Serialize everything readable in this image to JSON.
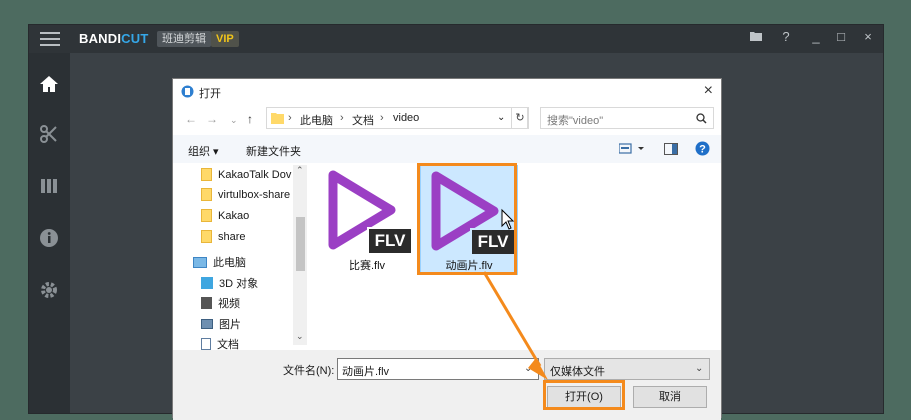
{
  "app": {
    "brand_main": "BANDI",
    "brand_accent": "CUT",
    "brand_sub": "班迪剪辑",
    "vip": "VIP",
    "accent_color": "#35a7e8",
    "vip_color": "#f0c419"
  },
  "window_controls": [
    "folder-icon",
    "?",
    "_",
    "□",
    "×"
  ],
  "sidebar": {
    "items": [
      {
        "name": "home-icon"
      },
      {
        "name": "cut-icon"
      },
      {
        "name": "join-icon"
      },
      {
        "name": "info-icon"
      },
      {
        "name": "settings-icon"
      }
    ]
  },
  "dialog": {
    "title": "打开",
    "breadcrumb": [
      "此电脑",
      "文档",
      "video"
    ],
    "search_placeholder": "搜索\"video\"",
    "toolbar": {
      "organize": "组织 ▾",
      "new_folder": "新建文件夹"
    },
    "tree": [
      {
        "label": "KakaoTalk Dov",
        "icon": "folder"
      },
      {
        "label": "virtulbox-share",
        "icon": "folder"
      },
      {
        "label": "Kakao",
        "icon": "folder"
      },
      {
        "label": "share",
        "icon": "folder"
      },
      {
        "label": "此电脑",
        "icon": "pc"
      },
      {
        "label": "3D 对象",
        "icon": "cube"
      },
      {
        "label": "视频",
        "icon": "film"
      },
      {
        "label": "图片",
        "icon": "pic"
      },
      {
        "label": "文档",
        "icon": "doc"
      }
    ],
    "files": [
      {
        "name": "比赛.flv",
        "badge": "FLV",
        "selected": false
      },
      {
        "name": "动画片.flv",
        "badge": "FLV",
        "selected": true
      }
    ],
    "filename_label": "文件名(N):",
    "filename_value": "动画片.flv",
    "filter_value": "仅媒体文件",
    "open_button": "打开(O)",
    "cancel_button": "取消",
    "highlight_color": "#f48a1c",
    "play_color": "#9b3fc4"
  }
}
